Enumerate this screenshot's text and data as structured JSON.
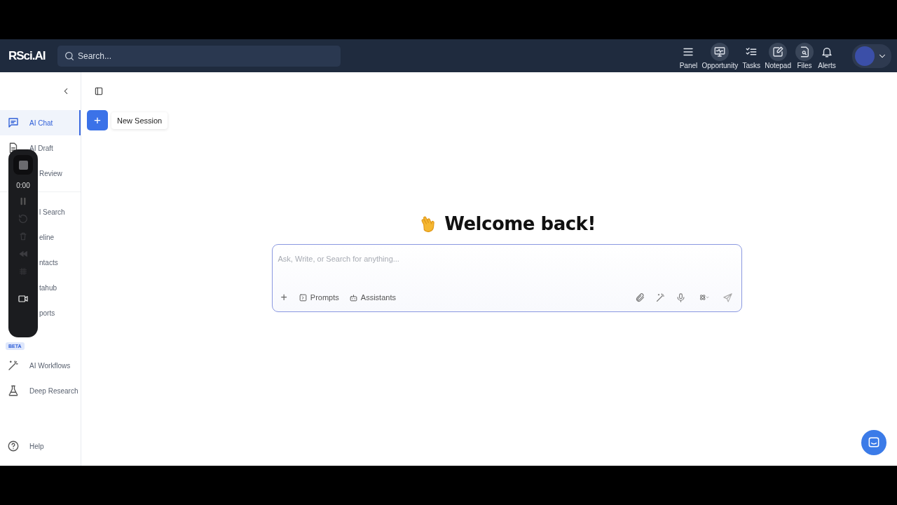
{
  "header": {
    "logo": "RSci.AI",
    "search": {
      "placeholder": "Search..."
    },
    "actions": [
      {
        "label": "Panel",
        "highlighted": false
      },
      {
        "label": "Opportunity",
        "highlighted": true
      },
      {
        "label": "Tasks",
        "highlighted": false
      },
      {
        "label": "Notepad",
        "highlighted": true
      },
      {
        "label": "Files",
        "highlighted": true
      },
      {
        "label": "Alerts",
        "highlighted": false
      }
    ]
  },
  "sidebar": {
    "items": [
      {
        "label": "AI Chat",
        "kind": "item",
        "selected": true
      },
      {
        "label": "AI Draft",
        "kind": "item",
        "selected": false
      },
      {
        "label": "Review",
        "kind": "covered",
        "selected": false
      }
    ],
    "items_2": [
      {
        "label": "l Search",
        "kind": "covered",
        "selected": false
      },
      {
        "label": "eline",
        "kind": "covered",
        "selected": false
      },
      {
        "label": "ntacts",
        "kind": "covered",
        "selected": false
      },
      {
        "label": "tahub",
        "kind": "covered",
        "selected": false
      },
      {
        "label": "ports",
        "kind": "covered",
        "selected": false
      }
    ],
    "beta_badge": "BETA",
    "items_3": [
      {
        "label": "AI Workflows",
        "kind": "item",
        "selected": false
      },
      {
        "label": "Deep Research",
        "kind": "item",
        "selected": false
      }
    ],
    "help": "Help"
  },
  "recorder": {
    "time": "0:00"
  },
  "main": {
    "new_session": {
      "button": "+",
      "label": "New Session"
    },
    "welcome": "Welcome back!",
    "composer": {
      "placeholder": "Ask, Write, or Search for anything...",
      "add": "+",
      "tools": [
        "Prompts",
        "Assistants"
      ]
    }
  }
}
